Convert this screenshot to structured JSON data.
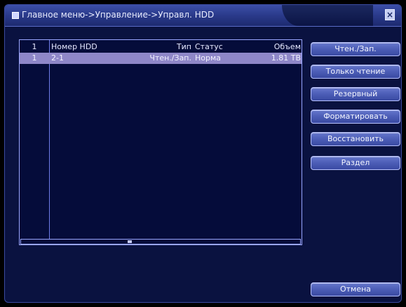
{
  "window": {
    "title": "Главное меню->Управление->Управл. HDD",
    "close_label": "×"
  },
  "table": {
    "headers": [
      "1",
      "Номер HDD",
      "Тип",
      "Статус",
      "Объем"
    ],
    "rows": [
      [
        "1",
        "2-1",
        "Чтен./Зап.",
        "Норма",
        "1.81 TB"
      ]
    ],
    "hscroll_label": ""
  },
  "buttons": {
    "read_write": "Чтен./Зап.",
    "read_only": "Только чтение",
    "reserved": "Резервный",
    "format": "Форматировать",
    "restore": "Восстановить",
    "partition": "Раздел",
    "cancel": "Отмена"
  },
  "colors": {
    "window_bg": "#0a1240",
    "title_bar": "#2a3a8a",
    "selected_row": "#8f87c8",
    "button_face": "#4c5db6",
    "border": "#9aa6ff"
  }
}
